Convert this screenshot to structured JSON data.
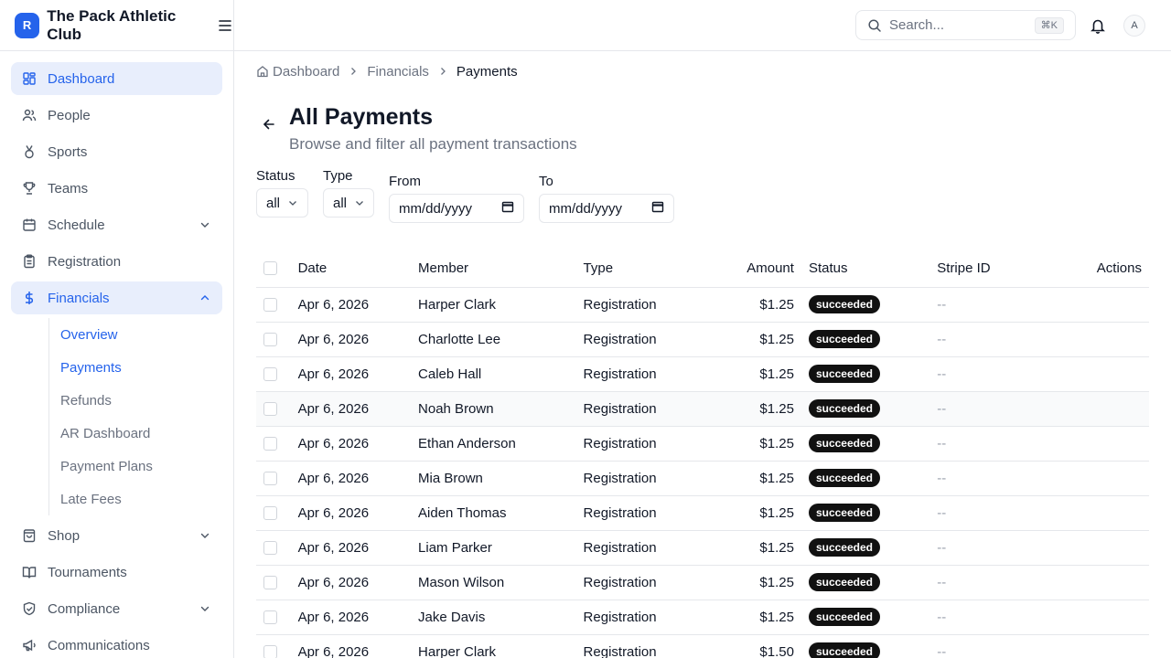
{
  "brand": {
    "initial": "R",
    "name": "The Pack Athletic Club"
  },
  "sidebar": {
    "items": [
      {
        "label": "Dashboard",
        "icon": "dashboard-icon",
        "active": true
      },
      {
        "label": "People",
        "icon": "people-icon"
      },
      {
        "label": "Sports",
        "icon": "medal-icon"
      },
      {
        "label": "Teams",
        "icon": "trophy-icon"
      },
      {
        "label": "Schedule",
        "icon": "calendar-icon",
        "chevron": "down"
      },
      {
        "label": "Registration",
        "icon": "clipboard-icon"
      },
      {
        "label": "Financials",
        "icon": "dollar-icon",
        "chevron": "up",
        "active": true
      }
    ],
    "financials_sub": [
      {
        "label": "Overview",
        "active": true
      },
      {
        "label": "Payments",
        "active": true
      },
      {
        "label": "Refunds"
      },
      {
        "label": "AR Dashboard"
      },
      {
        "label": "Payment Plans"
      },
      {
        "label": "Late Fees"
      }
    ],
    "items_after": [
      {
        "label": "Shop",
        "icon": "bag-icon",
        "chevron": "down"
      },
      {
        "label": "Tournaments",
        "icon": "book-icon"
      },
      {
        "label": "Compliance",
        "icon": "shield-icon",
        "chevron": "down"
      },
      {
        "label": "Communications",
        "icon": "megaphone-icon"
      }
    ]
  },
  "header": {
    "search_placeholder": "Search...",
    "search_shortcut": "⌘K",
    "avatar_initial": "A"
  },
  "breadcrumb": [
    "Dashboard",
    "Financials",
    "Payments"
  ],
  "page": {
    "title": "All Payments",
    "subtitle": "Browse and filter all payment transactions"
  },
  "filters": {
    "status_label": "Status",
    "status_value": "all",
    "type_label": "Type",
    "type_value": "all",
    "from_label": "From",
    "from_placeholder": "mm/dd/yyyy",
    "to_label": "To",
    "to_placeholder": "mm/dd/yyyy"
  },
  "table": {
    "columns": [
      "Date",
      "Member",
      "Type",
      "Amount",
      "Status",
      "Stripe ID",
      "Actions"
    ],
    "rows": [
      {
        "date": "Apr 6, 2026",
        "member": "Harper Clark",
        "type": "Registration",
        "amount": "$1.25",
        "status": "succeeded",
        "stripe": "--"
      },
      {
        "date": "Apr 6, 2026",
        "member": "Charlotte Lee",
        "type": "Registration",
        "amount": "$1.25",
        "status": "succeeded",
        "stripe": "--"
      },
      {
        "date": "Apr 6, 2026",
        "member": "Caleb Hall",
        "type": "Registration",
        "amount": "$1.25",
        "status": "succeeded",
        "stripe": "--"
      },
      {
        "date": "Apr 6, 2026",
        "member": "Noah Brown",
        "type": "Registration",
        "amount": "$1.25",
        "status": "succeeded",
        "stripe": "--"
      },
      {
        "date": "Apr 6, 2026",
        "member": "Ethan Anderson",
        "type": "Registration",
        "amount": "$1.25",
        "status": "succeeded",
        "stripe": "--"
      },
      {
        "date": "Apr 6, 2026",
        "member": "Mia Brown",
        "type": "Registration",
        "amount": "$1.25",
        "status": "succeeded",
        "stripe": "--"
      },
      {
        "date": "Apr 6, 2026",
        "member": "Aiden Thomas",
        "type": "Registration",
        "amount": "$1.25",
        "status": "succeeded",
        "stripe": "--"
      },
      {
        "date": "Apr 6, 2026",
        "member": "Liam Parker",
        "type": "Registration",
        "amount": "$1.25",
        "status": "succeeded",
        "stripe": "--"
      },
      {
        "date": "Apr 6, 2026",
        "member": "Mason Wilson",
        "type": "Registration",
        "amount": "$1.25",
        "status": "succeeded",
        "stripe": "--"
      },
      {
        "date": "Apr 6, 2026",
        "member": "Jake Davis",
        "type": "Registration",
        "amount": "$1.25",
        "status": "succeeded",
        "stripe": "--"
      },
      {
        "date": "Apr 6, 2026",
        "member": "Harper Clark",
        "type": "Registration",
        "amount": "$1.50",
        "status": "succeeded",
        "stripe": "--"
      }
    ]
  },
  "colors": {
    "accent": "#2563eb",
    "active_bg": "#e8eefc",
    "badge": "#111111"
  }
}
